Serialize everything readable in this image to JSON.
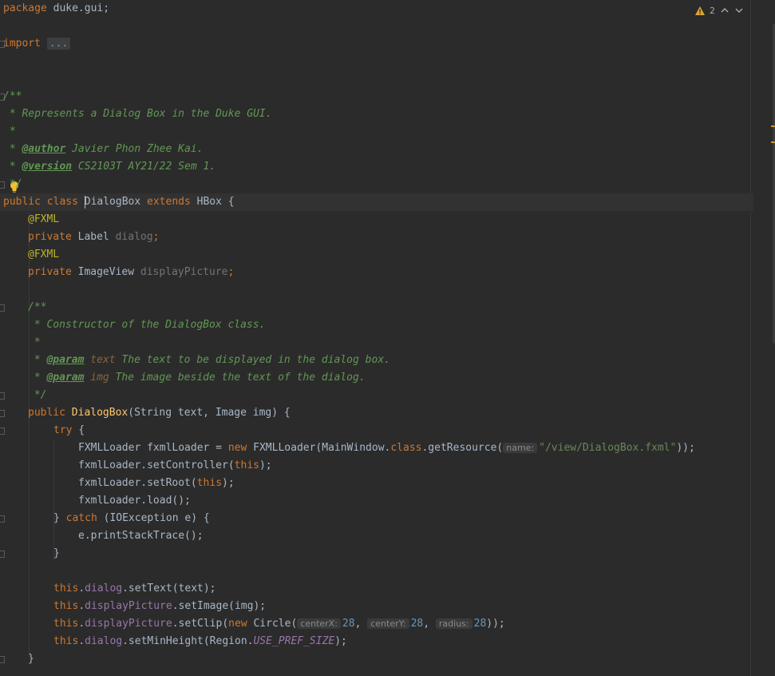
{
  "inspections": {
    "warning_count": "2",
    "icons": [
      "warning-triangle-icon",
      "chevron-up-icon",
      "chevron-down-icon"
    ],
    "warning_color": "#e0a537"
  },
  "code": {
    "pkg_kw": "package",
    "pkg_name": " duke.gui;",
    "import_kw": "import",
    "import_folded": "...",
    "doc_open": "/**",
    "doc_desc": " * Represents a Dialog Box in the Duke GUI.",
    "doc_star": " *",
    "doc_star_prefix": " * ",
    "author_tag": "@author",
    "author_val": " Javier Phon Zhee Kai.",
    "version_tag": "@version",
    "version_val": " CS2103T AY21/22 Sem 1.",
    "doc_close": " */",
    "class_kw": "public class ",
    "class_name": "DialogBox",
    "extends_kw": " extends ",
    "super_name": "HBox {",
    "fxml_ann": "@FXML",
    "private_kw": "private ",
    "label_type": "Label ",
    "dialog_field": "dialog",
    "semi": ";",
    "imageview_type": "ImageView ",
    "displaypicture_field": "displayPicture",
    "ctor_doc_open": "/**",
    "ctor_doc_desc": " * Constructor of the DialogBox class.",
    "ctor_doc_star": " *",
    "param_tag": "@param",
    "param_text_name": " text",
    "param_text_desc": " The text to be displayed in the dialog box.",
    "param_img_name": " img",
    "param_img_desc": " The image beside the text of the dialog.",
    "ctor_doc_close": " */",
    "public_kw": "public ",
    "ctor_name": "DialogBox",
    "ctor_params": "(String text, Image img) {",
    "try_kw": "try",
    "brace_open": " {",
    "loader_decl": "FXMLLoader fxmlLoader = ",
    "new_kw": "new",
    "loader_ctor": " FXMLLoader(MainWindow.",
    "class_kw2": "class",
    "get_resource": ".getResource(",
    "hint_name": "name:",
    "fxml_path": "\"/view/DialogBox.fxml\"",
    "close_call": "));",
    "set_controller": "fxmlLoader.setController(",
    "this_kw": "this",
    "paren_semi": ");",
    "set_root": "fxmlLoader.setRoot(",
    "load_call": "fxmlLoader.load();",
    "catch_close": "} ",
    "catch_kw": "catch",
    "catch_args": " (IOException e) {",
    "print_stack": "e.printStackTrace();",
    "brace_close": "}",
    "dot": ".",
    "set_text": ".setText(text);",
    "set_image": ".setImage(img);",
    "set_clip": ".setClip(",
    "circle": " Circle(",
    "hint_centerx": "centerX:",
    "hint_centery": "centerY:",
    "hint_radius": "radius:",
    "num_28": "28",
    "comma_space": ", ",
    "set_min_height": ".setMinHeight(Region.",
    "use_pref_size": "USE_PREF_SIZE",
    "final_close": "}"
  }
}
